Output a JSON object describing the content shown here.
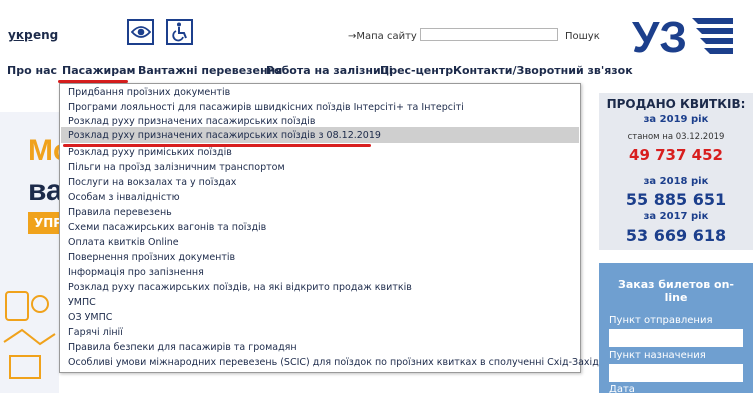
{
  "header": {
    "lang_uk": "укр",
    "lang_en": "eng",
    "sitemap_label": "→Мапа сайту",
    "search_placeholder": "",
    "search_label": "Пошук",
    "logo_text": "УЗ"
  },
  "nav": {
    "items": [
      "Про нас",
      "Пасажирам",
      "Вантажні перевезення",
      "Робота на залізниці",
      "Прес-центр",
      "Контакти/Зворотний зв'язок"
    ]
  },
  "dropdown": {
    "items": [
      "Придбання проїзних документів",
      "Програми лояльності для пасажирів швидкісних поїздів Інтерсіті+ та Інтерсіті",
      "Розклад руху призначених пасажирських поїздів",
      "Розклад руху призначених пасажирських поїздів з 08.12.2019",
      "Розклад руху приміських поїздів",
      "Пільги на проїзд залізничним транспортом",
      "Послуги на вокзалах та у поїздах",
      "Особам з інвалідністю",
      "Правила перевезень",
      "Схеми пасажирських вагонів та поїздів",
      "Оплата квитків Online",
      "Повернення проїзних документів",
      "Інформація про запізнення",
      "Розклад руху пасажирських поїздів, на які відкрито продаж квитків",
      "УМПС",
      "ОЗ УМПС",
      "Гарячі лінії",
      "Правила безпеки для пасажирів та громадян",
      "Особливі умови міжнародних перевезень (SCIC) для поїздок по проїзних квитках в сполученні Схід-Захід (EWT)"
    ],
    "highlighted_index": 3
  },
  "background_banner": {
    "line1": "Мо",
    "line2": "ва",
    "button": "УПР"
  },
  "tickets": {
    "title": "ПРОДАНО КВИТКІВ:",
    "year_2019": "за 2019 рік",
    "as_of": "станом на 03.12.2019",
    "count_2019": "49 737 452",
    "year_2018": "за 2018 рік",
    "count_2018": "55 885 651",
    "year_2017": "за 2017 рік",
    "count_2017": "53 669 618"
  },
  "booking": {
    "title": "Заказ билетов on-line",
    "from_label": "Пункт отправления",
    "to_label": "Пункт назначения",
    "date_label": "Дата"
  },
  "colors": {
    "brand_blue": "#1c3f8c",
    "accent_red": "#d81e1e",
    "booking_bg": "#6f9fd0",
    "banner_orange": "#f0a21c"
  }
}
